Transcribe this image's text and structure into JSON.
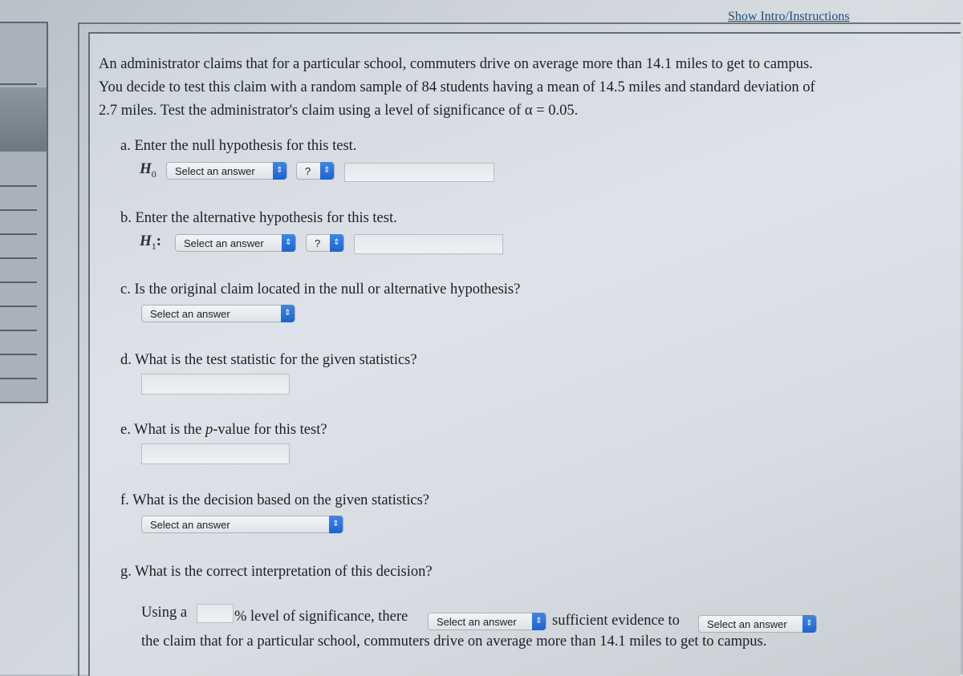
{
  "header": {
    "show_intro_link": "Show Intro/Instructions"
  },
  "problem": {
    "text": "An administrator claims that for a particular school, commuters drive on average more than 14.1 miles to get to campus. You decide to test this claim with a random sample of 84 students having a mean of 14.5 miles and standard deviation of 2.7 miles. Test the administrator's claim using a level of significance of α = 0.05."
  },
  "questions": {
    "a": {
      "label": "a. Enter the null hypothesis for this test.",
      "symbol": "H",
      "subscript": "0",
      "suffix": "",
      "select_value": "Select an answer",
      "operator_value": "?",
      "input_value": ""
    },
    "b": {
      "label": "b. Enter the alternative hypothesis for this test.",
      "symbol": "H",
      "subscript": "1",
      "suffix": ":",
      "select_value": "Select an answer",
      "operator_value": "?",
      "input_value": ""
    },
    "c": {
      "label": "c. Is the original claim located in the null or alternative hypothesis?",
      "select_value": "Select an answer"
    },
    "d": {
      "label": "d. What is the test statistic for the given statistics?",
      "input_value": ""
    },
    "e": {
      "label_pre": "e. What is the ",
      "label_p": "p",
      "label_post": "-value for this test?",
      "input_value": ""
    },
    "f": {
      "label": "f. What is the decision based on the given statistics?",
      "select_value": "Select an answer"
    },
    "g": {
      "label": "g. What is the correct interpretation of this decision?",
      "text_using": "Using a",
      "percent_input_value": "",
      "text_level": "% level of significance, there",
      "select1_value": "Select an answer",
      "text_sufficient": "sufficient evidence to",
      "select2_value": "Select an answer",
      "text_claim": "the claim that for a particular school, commuters drive on average more than 14.1 miles to get to campus."
    }
  },
  "icons": {
    "select_arrow": "⇕"
  }
}
